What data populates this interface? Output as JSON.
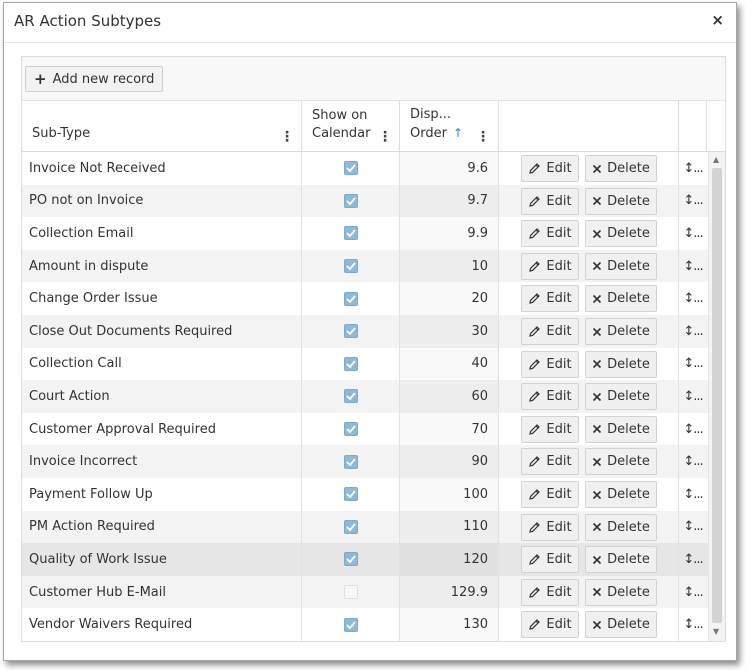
{
  "dialog": {
    "title": "AR Action Subtypes",
    "close_glyph": "×"
  },
  "toolbar": {
    "add_icon": "+",
    "add_label": "Add new record"
  },
  "columns": {
    "subtype": "Sub-Type",
    "show_calendar_line1": "Show on",
    "show_calendar_line2": "Calendar",
    "order_line1": "Disp...",
    "order_line2": "Order",
    "sort_indicator": "↑",
    "menu_glyph": "⋮"
  },
  "actions": {
    "edit_label": "Edit",
    "delete_label": "Delete",
    "drag_glyph": "↕..."
  },
  "rows": [
    {
      "subtype": "Invoice Not Received",
      "show": true,
      "order": "9.6"
    },
    {
      "subtype": "PO not on Invoice",
      "show": true,
      "order": "9.7"
    },
    {
      "subtype": "Collection Email",
      "show": true,
      "order": "9.9"
    },
    {
      "subtype": "Amount in dispute",
      "show": true,
      "order": "10"
    },
    {
      "subtype": "Change Order Issue",
      "show": true,
      "order": "20"
    },
    {
      "subtype": "Close Out Documents Required",
      "show": true,
      "order": "30"
    },
    {
      "subtype": "Collection Call",
      "show": true,
      "order": "40"
    },
    {
      "subtype": "Court Action",
      "show": true,
      "order": "60"
    },
    {
      "subtype": "Customer Approval Required",
      "show": true,
      "order": "70"
    },
    {
      "subtype": "Invoice Incorrect",
      "show": true,
      "order": "90"
    },
    {
      "subtype": "Payment Follow Up",
      "show": true,
      "order": "100"
    },
    {
      "subtype": "PM Action Required",
      "show": true,
      "order": "110"
    },
    {
      "subtype": "Quality of Work Issue",
      "show": true,
      "order": "120"
    },
    {
      "subtype": "Customer Hub E-Mail",
      "show": false,
      "order": "129.9"
    },
    {
      "subtype": "Vendor Waivers Required",
      "show": true,
      "order": "130"
    }
  ],
  "highlighted_row": 12,
  "colors": {
    "checkbox_checked": "#8fb9d7",
    "sort_arrow": "#3a7bd5",
    "row_alt": "#f3f3f3"
  }
}
